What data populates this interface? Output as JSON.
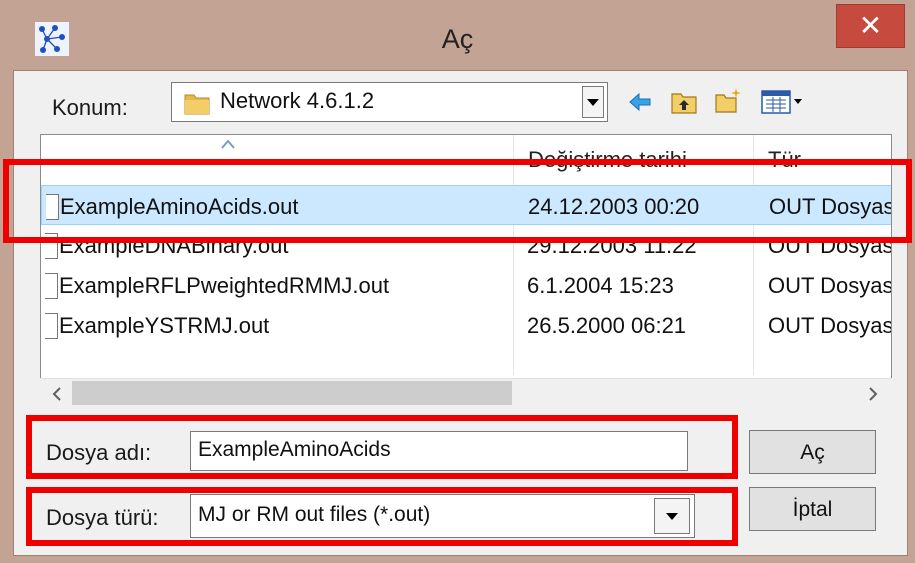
{
  "window": {
    "title": "Aç",
    "close_label": "✕",
    "app_icon": "network-app-icon"
  },
  "toolbar": {
    "location_label": "Konum:",
    "location_value": "Network 4.6.1.2",
    "icons": [
      "back-arrow-icon",
      "up-folder-icon",
      "new-folder-icon",
      "view-menu-icon"
    ]
  },
  "file_list": {
    "columns": [
      "",
      "Değiştirme tarihi",
      "Tür"
    ],
    "rows": [
      {
        "name": "ExampleAminoAcids.out",
        "date": "24.12.2003 00:20",
        "type": "OUT Dosyası",
        "selected": true
      },
      {
        "name": "ExampleDNABinary.out",
        "date": "29.12.2003 11:22",
        "type": "OUT Dosyası",
        "selected": false
      },
      {
        "name": "ExampleRFLPweightedRMMJ.out",
        "date": "6.1.2004 15:23",
        "type": "OUT Dosyası",
        "selected": false
      },
      {
        "name": "ExampleYSTRMJ.out",
        "date": "26.5.2000 06:21",
        "type": "OUT Dosyası",
        "selected": false
      }
    ]
  },
  "form": {
    "filename_label": "Dosya adı:",
    "filename_value": "ExampleAminoAcids",
    "filetype_label": "Dosya türü:",
    "filetype_value": "MJ or RM out files (*.out)",
    "open_button": "Aç",
    "cancel_button": "İptal"
  },
  "colors": {
    "frame": "#c3a393",
    "close": "#c74a3e",
    "selection": "#cce8ff",
    "highlight": "#ee0000"
  }
}
